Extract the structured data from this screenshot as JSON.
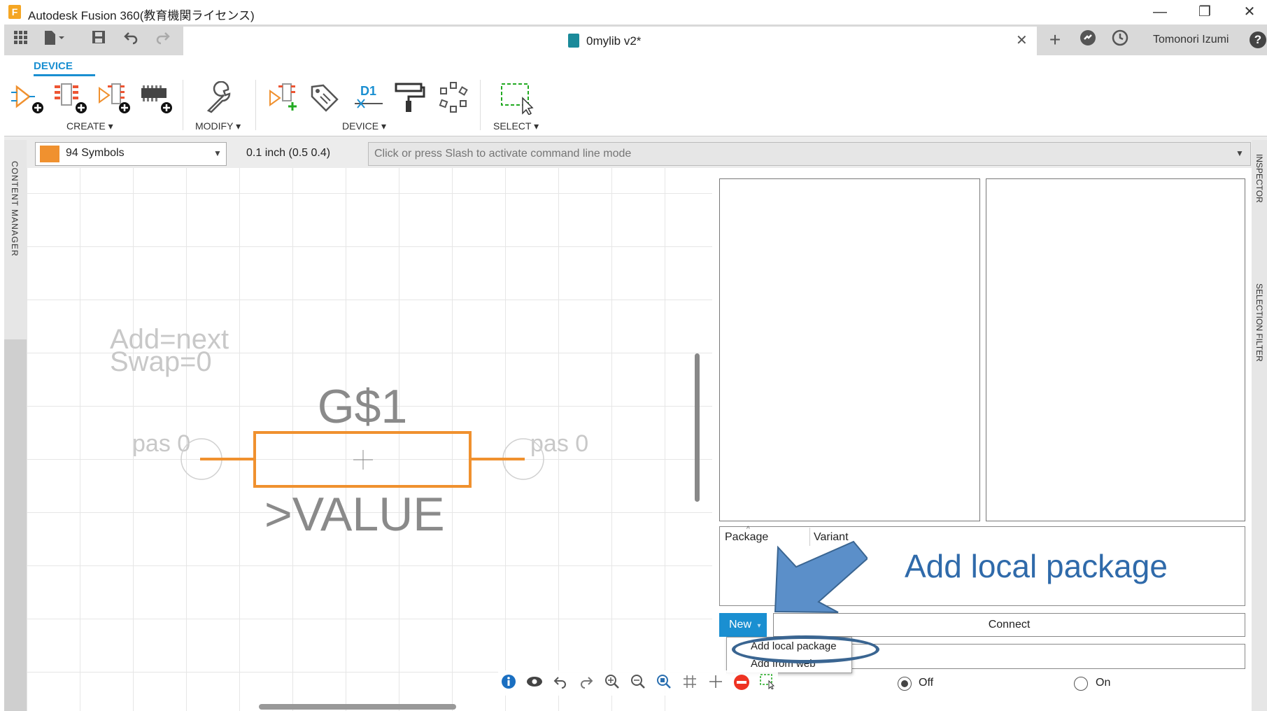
{
  "app": {
    "title": "Autodesk Fusion 360(教育機関ライセンス)",
    "logo_letter": "F",
    "window_controls": {
      "minimize": "—",
      "restore": "❐",
      "close": "✕"
    }
  },
  "tabbar": {
    "doc_title": "0mylib v2*",
    "close_glyph": "✕",
    "new_tab_glyph": "+",
    "user": "Tomonori Izumi",
    "help_glyph": "?"
  },
  "ribbon": {
    "active_tab": "DEVICE",
    "groups": {
      "create": "CREATE ▾",
      "modify": "MODIFY ▾",
      "device": "DEVICE ▾",
      "select": "SELECT ▾"
    },
    "device_icon_label": "D1"
  },
  "command_row": {
    "layer": "94 Symbols",
    "grid_info": "0.1 inch (0.5 0.4)",
    "command_placeholder": "Click or press Slash to activate command line mode",
    "layer_color": "#f0912f"
  },
  "side": {
    "content_manager": "CONTENT MANAGER",
    "inspector": "INSPECTOR",
    "selection_filter": "SELECTION FILTER"
  },
  "symbol": {
    "add_text": "Add=next",
    "swap_text": "Swap=0",
    "name": "G$1",
    "value": ">VALUE",
    "pin_left": "pas 0",
    "pin_right": "pas 0",
    "outline_color": "#f0912f"
  },
  "panel": {
    "col_package": "Package",
    "col_variant": "Variant",
    "new_label": "New",
    "new_caret": "▾",
    "connect_label": "Connect",
    "dropdown": [
      "Add local package",
      "Add from web"
    ],
    "radio_off": "Off",
    "radio_on": "On",
    "radio_selected": "Off"
  },
  "annotation": {
    "text": "Add local package",
    "color": "#2f6aaa"
  }
}
